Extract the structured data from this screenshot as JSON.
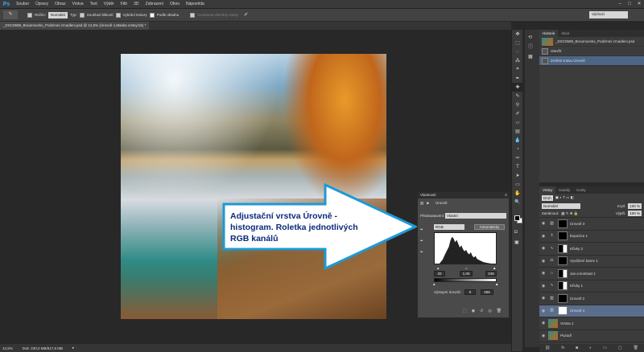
{
  "app": {
    "logo": "Ps"
  },
  "menu": [
    "Soubor",
    "Úpravy",
    "Obraz",
    "Vrstva",
    "Text",
    "Výběr",
    "Filtr",
    "3D",
    "Zobrazení",
    "Okno",
    "Nápověda"
  ],
  "window_controls": [
    "–",
    "□",
    "✕"
  ],
  "options_bar": {
    "mode_label": "Režim:",
    "mode_value": "Normální",
    "type_label": "Typ:",
    "opt1": "Souhlasí blikostí",
    "opt2": "Vybrání textury",
    "opt3": "Podle obsahu",
    "opt4": "Vzorkovat všechny vrstvy",
    "workspace": "Výchozí"
  },
  "document_tab": "_DSC0598_Broumovsko_Podzimni zrcadleni.psd @ 12,5% (Úrovně 1,Maska vrstvy/16) *",
  "status": {
    "zoom": "12,5%",
    "doc": "Dok: 230,0 MB/817,6 MB"
  },
  "history": {
    "tabs": [
      "Historie",
      "Akce"
    ],
    "snapshot": "_DSC0598_Broumovsko_Podzimni zrcadleni.psd",
    "items": [
      "Otevřít",
      "Změnit vrstvu Úrovně"
    ]
  },
  "properties": {
    "title": "Vlastnosti",
    "adj_name": "Úrovně",
    "preset_label": "Přednastavení:",
    "preset_value": "Vlastní",
    "channel": "RGB",
    "auto": "Automaticky",
    "input": [
      "20",
      "1,00",
      "245"
    ],
    "output_label": "Výstupní úrovně:",
    "output": [
      "0",
      "255"
    ]
  },
  "callout": {
    "line1": "Adjustační vrstva Úrovně -",
    "line2": "histogram. Roletka jednotlivých",
    "line3": "RGB kanálů"
  },
  "layers": {
    "tabs": [
      "Vrstvy",
      "Kanály",
      "Cesty"
    ],
    "kind": "Druh",
    "blend": "Normální",
    "opacity_label": "Krytí:",
    "opacity": "100 %",
    "lock_label": "Zamknout:",
    "fill_label": "Výplň:",
    "fill": "100 %",
    "items": [
      {
        "name": "Úrovně 3",
        "icon": "levels",
        "mask": "black"
      },
      {
        "name": "Expozice 1",
        "icon": "exposure",
        "mask": "black"
      },
      {
        "name": "Křivky 2",
        "icon": "curves",
        "mask": "mixed"
      },
      {
        "name": "Vyvážení barev 1",
        "icon": "balance",
        "mask": "black"
      },
      {
        "name": "Jas a kontrast 1",
        "icon": "brightness",
        "mask": "mixed"
      },
      {
        "name": "Křivky 1",
        "icon": "curves",
        "mask": "mixed"
      },
      {
        "name": "Úrovně 2",
        "icon": "levels",
        "mask": "black"
      },
      {
        "name": "Úrovně 1",
        "icon": "levels",
        "mask": "white",
        "selected": true
      },
      {
        "name": "Vrstva 1",
        "icon": "pixel",
        "mask": "none"
      },
      {
        "name": "Pozadí",
        "icon": "pixel",
        "mask": "none"
      }
    ]
  },
  "colors": {
    "accent": "#1c9ad6",
    "callout_text": "#0b2a7a",
    "selection": "#5a6e8c"
  }
}
